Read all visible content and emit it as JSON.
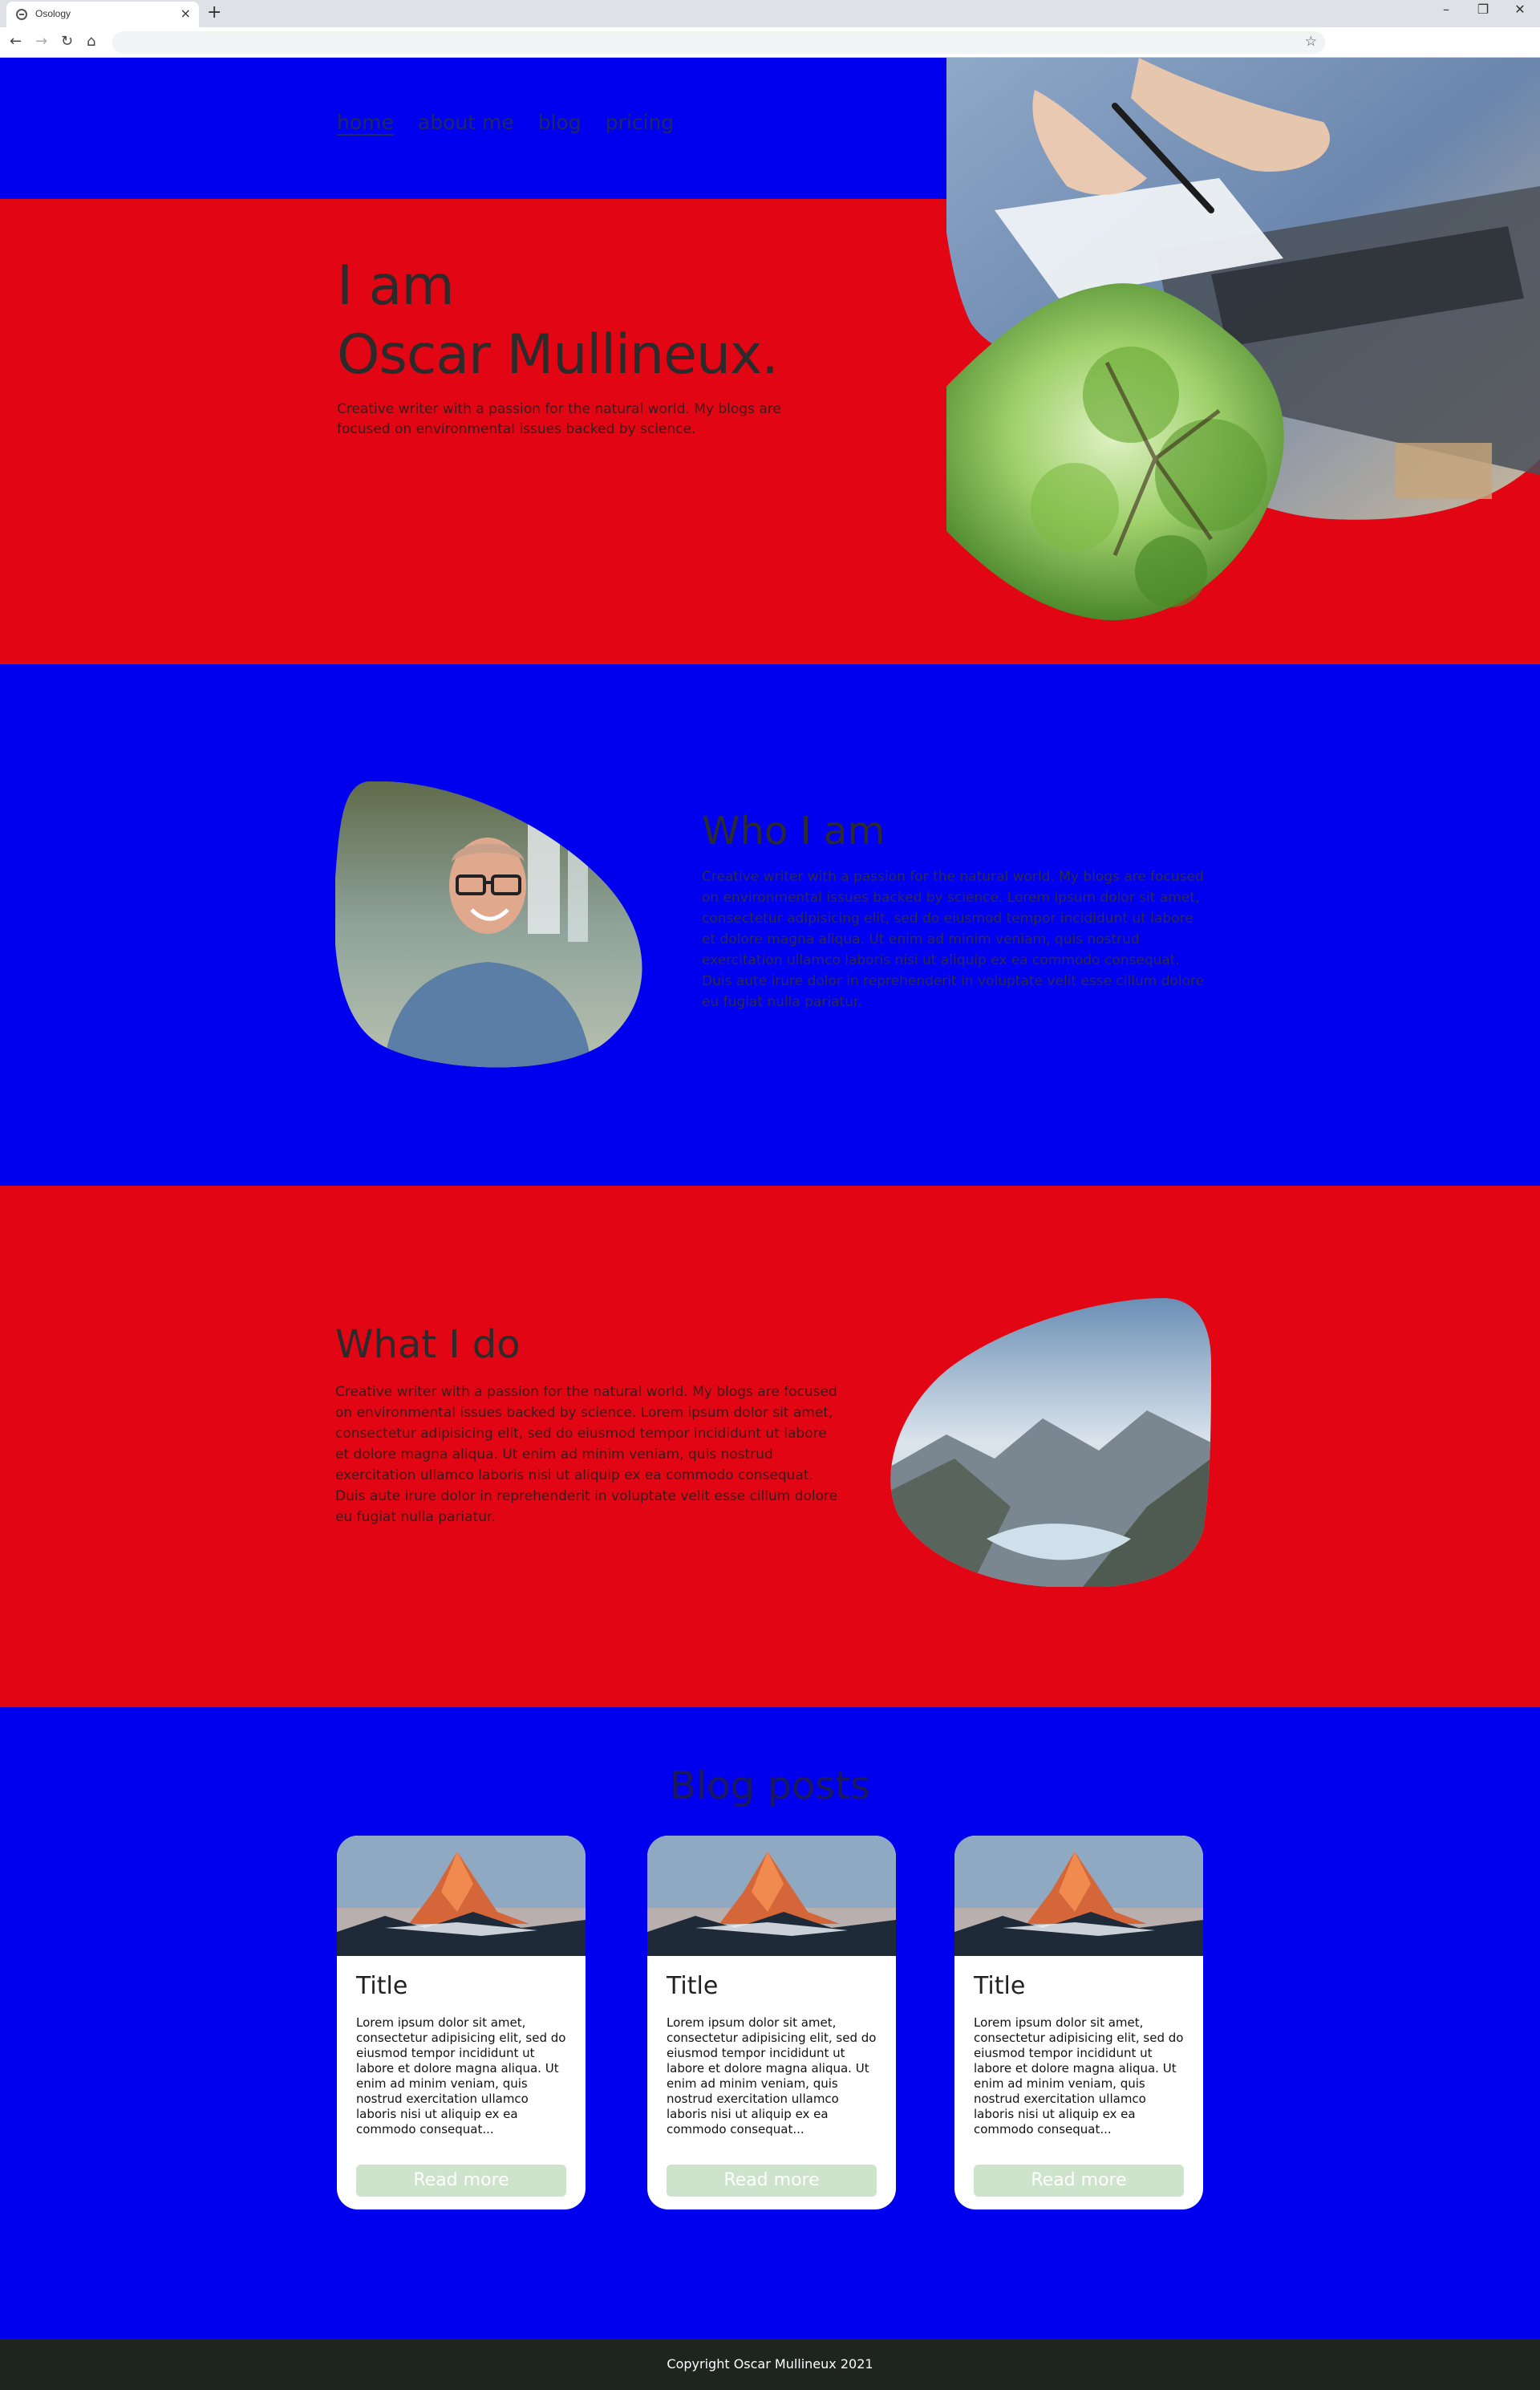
{
  "browser": {
    "tab_title": "Osology",
    "tab_close": "×",
    "new_tab": "+",
    "minimize": "–",
    "restore": "❐",
    "close": "✕",
    "back": "←",
    "forward": "→",
    "reload": "↻",
    "home": "⌂",
    "bookmark": "☆"
  },
  "nav": {
    "items": [
      "home",
      "about me",
      "blog",
      "pricing"
    ],
    "active": "home"
  },
  "hero": {
    "title_line1": "I am",
    "title_line2": "Oscar Mullineux.",
    "subtitle": "Creative writer with a passion for the natural world. My blogs are focused on environmental issues backed by science."
  },
  "about": {
    "heading": "Who I am",
    "body": "Creative writer with a passion for the natural world. My blogs are focused on environmental issues backed by science. Lorem ipsum dolor sit amet, consectetur adipisicing elit, sed do eiusmod tempor incididunt ut labore et dolore magna aliqua. Ut enim ad minim veniam, quis nostrud exercitation ullamco laboris nisi ut aliquip ex ea commodo consequat. Duis aute irure dolor in reprehenderit in voluptate velit esse cillum dolore eu fugiat nulla pariatur."
  },
  "work": {
    "heading": "What I do",
    "body": "Creative writer with a passion for the natural world. My blogs are focused on environmental issues backed by science. Lorem ipsum dolor sit amet, consectetur adipisicing elit, sed do eiusmod tempor incididunt ut labore et dolore magna aliqua. Ut enim ad minim veniam, quis nostrud exercitation ullamco laboris nisi ut aliquip ex ea commodo consequat. Duis aute irure dolor in reprehenderit in voluptate velit esse cillum dolore eu fugiat nulla pariatur."
  },
  "blog": {
    "heading": "Blog posts",
    "cards": [
      {
        "title": "Title",
        "excerpt": "Lorem ipsum dolor sit amet, consectetur adipisicing elit, sed do eiusmod tempor incididunt ut labore et dolore magna aliqua. Ut enim ad minim veniam, quis nostrud exercitation ullamco laboris nisi ut aliquip ex ea commodo consequat...",
        "button": "Read more"
      },
      {
        "title": "Title",
        "excerpt": "Lorem ipsum dolor sit amet, consectetur adipisicing elit, sed do eiusmod tempor incididunt ut labore et dolore magna aliqua. Ut enim ad minim veniam, quis nostrud exercitation ullamco laboris nisi ut aliquip ex ea commodo consequat...",
        "button": "Read more"
      },
      {
        "title": "Title",
        "excerpt": "Lorem ipsum dolor sit amet, consectetur adipisicing elit, sed do eiusmod tempor incididunt ut labore et dolore magna aliqua. Ut enim ad minim veniam, quis nostrud exercitation ullamco laboris nisi ut aliquip ex ea commodo consequat...",
        "button": "Read more"
      }
    ]
  },
  "footer": {
    "copyright": "Copyright Oscar Mullineux 2021"
  },
  "colors": {
    "blue": "#0000ee",
    "red": "#e20614",
    "footer": "#1e241e",
    "button": "#cde3cb"
  }
}
